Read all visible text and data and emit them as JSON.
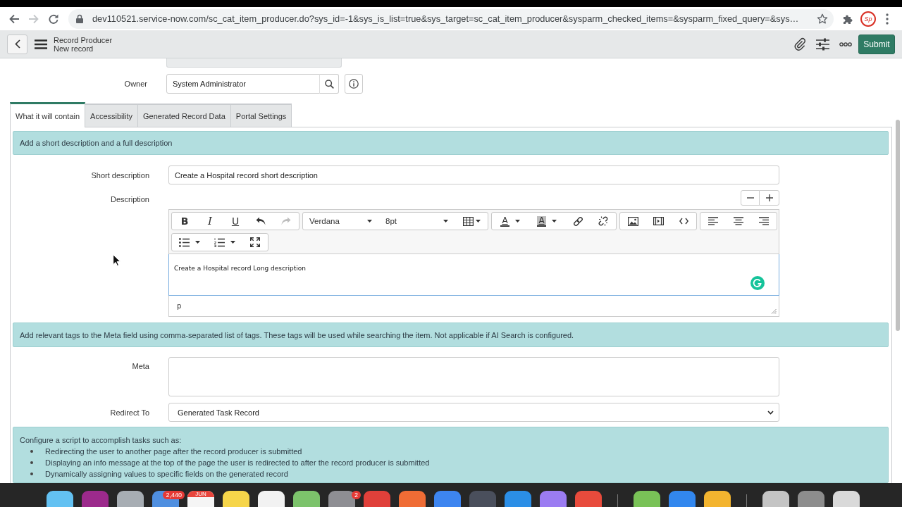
{
  "browser": {
    "url": "dev110521.service-now.com/sc_cat_item_producer.do?sys_id=-1&sys_is_list=true&sys_target=sc_cat_item_producer&sysparm_checked_items=&sysparm_fixed_query=&sys…",
    "forward_disabled": true,
    "profile_initials": "Sp"
  },
  "header": {
    "title": "Record Producer",
    "subtitle": "New record",
    "submit_label": "Submit"
  },
  "owner": {
    "label": "Owner",
    "value": "System Administrator"
  },
  "tabs": [
    {
      "label": "What it will contain",
      "selected": true
    },
    {
      "label": "Accessibility",
      "selected": false
    },
    {
      "label": "Generated Record Data",
      "selected": false
    },
    {
      "label": "Portal Settings",
      "selected": false
    }
  ],
  "intro_banner": "Add a short description and a full description",
  "short_description": {
    "label": "Short description",
    "value": "Create a Hospital record short description"
  },
  "description": {
    "label": "Description",
    "toolbar": {
      "bold": "B",
      "italic": "I",
      "underline": "U",
      "redo_disabled": true,
      "font": "Verdana",
      "size": "8pt",
      "text_color": "A",
      "background_color": "A"
    },
    "content": "Create a Hospital record Long description",
    "element_path": "p"
  },
  "meta_banner": "Add relevant tags to the Meta field using comma-separated list of tags. These tags will be used while searching the item. Not applicable if AI Search is configured.",
  "meta": {
    "label": "Meta"
  },
  "redirect": {
    "label": "Redirect To",
    "value": "Generated Task Record"
  },
  "script_banner": {
    "intro": "Configure a script to accomplish tasks such as:",
    "items": [
      "Redirecting the user to another page after the record producer is submitted",
      "Displaying an info message at the top of the page the user is redirected to after the record producer is submitted",
      "Dynamically assigning values to specific fields on the generated record"
    ]
  },
  "dock": [
    {
      "kind": "app",
      "color": "#63c1f2"
    },
    {
      "kind": "app",
      "color": "#9c2a8c"
    },
    {
      "kind": "app",
      "color": "#a7adb3"
    },
    {
      "kind": "app",
      "color": "#4f8fe0",
      "badge": "2,440"
    },
    {
      "kind": "calendar",
      "color": "#f5f5f5",
      "label": "JUN"
    },
    {
      "kind": "app",
      "color": "#f6d54a"
    },
    {
      "kind": "app",
      "color": "#f2f2f2"
    },
    {
      "kind": "app",
      "color": "#7cc36b"
    },
    {
      "kind": "app",
      "color": "#8e8e93",
      "badge": "2"
    },
    {
      "kind": "app",
      "color": "#e0403a"
    },
    {
      "kind": "app",
      "color": "#ef6c35"
    },
    {
      "kind": "app",
      "color": "#3d85f0"
    },
    {
      "kind": "app",
      "color": "#4a4f5c"
    },
    {
      "kind": "app",
      "color": "#2b8ee6"
    },
    {
      "kind": "app",
      "color": "#9b7cf2"
    },
    {
      "kind": "app",
      "color": "#e84b3c"
    },
    {
      "kind": "separator"
    },
    {
      "kind": "app",
      "color": "#79c257"
    },
    {
      "kind": "app",
      "color": "#3287ee"
    },
    {
      "kind": "app",
      "color": "#f3b42f"
    },
    {
      "kind": "separator"
    },
    {
      "kind": "app",
      "color": "#c4c4c4"
    },
    {
      "kind": "app",
      "color": "#8d8d8d"
    },
    {
      "kind": "app",
      "color": "#d9d9d9"
    }
  ]
}
